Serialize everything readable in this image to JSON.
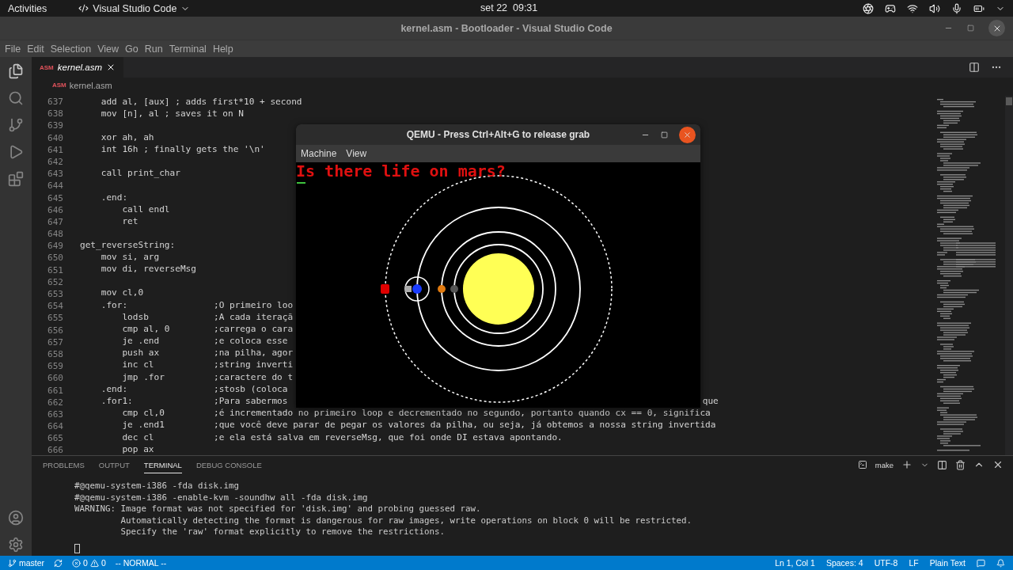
{
  "top_bar": {
    "activities": "Activities",
    "app_name": "Visual Studio Code",
    "clock": "set 22  09:31"
  },
  "window": {
    "title": "kernel.asm - Bootloader - Visual Studio Code"
  },
  "menu": [
    "File",
    "Edit",
    "Selection",
    "View",
    "Go",
    "Run",
    "Terminal",
    "Help"
  ],
  "editor_tabs": [
    {
      "icon_text": "ASM",
      "label": "kernel.asm",
      "selected": true
    }
  ],
  "breadcrumb": {
    "icon_text": "ASM",
    "label": "kernel.asm"
  },
  "code_lines": [
    {
      "n": "637",
      "code": "    add al, [aux] ; adds first*10 + second"
    },
    {
      "n": "638",
      "code": "    mov [n], al ; saves it on N"
    },
    {
      "n": "639"
    },
    {
      "n": "640",
      "code": "    xor ah, ah"
    },
    {
      "n": "641",
      "code": "    int 16h ; finally gets the '\\n'"
    },
    {
      "n": "642"
    },
    {
      "n": "643",
      "code": "    call print_char"
    },
    {
      "n": "644"
    },
    {
      "n": "645",
      "code": "    .end:"
    },
    {
      "n": "646",
      "code": "        call endl"
    },
    {
      "n": "647",
      "code": "        ret"
    },
    {
      "n": "648"
    },
    {
      "n": "649",
      "code": "get_reverseString:"
    },
    {
      "n": "650",
      "code": "    mov si, arg"
    },
    {
      "n": "651",
      "code": "    mov di, reverseMsg"
    },
    {
      "n": "652"
    },
    {
      "n": "653",
      "code": "    mov cl,0"
    },
    {
      "n": "654",
      "code": "    .for:",
      "comment": ";O primeiro loo"
    },
    {
      "n": "655",
      "code": "        lodsb",
      "comment": ";A cada iteraçã"
    },
    {
      "n": "656",
      "code": "        cmp al, 0",
      "comment": ";carrega o cara"
    },
    {
      "n": "657",
      "code": "        je .end",
      "comment": ";e coloca esse"
    },
    {
      "n": "658",
      "code": "        push ax",
      "comment": ";na pilha, agor"
    },
    {
      "n": "659",
      "code": "        inc cl",
      "comment": ";string inverti"
    },
    {
      "n": "660",
      "code": "        jmp .for",
      "comment": ";caractere do t"
    },
    {
      "n": "661",
      "code": "    .end:",
      "comment": ";stosb (coloca"
    },
    {
      "n": "662",
      "code": "    .for1:",
      "comment": ";Para sabermos",
      "tail": "que"
    },
    {
      "n": "663",
      "code": "        cmp cl,0",
      "comment": ";é incrementado no primeiro loop e decrementado no segundo, portanto quando cx == 0, significa"
    },
    {
      "n": "664",
      "code": "        je .end1",
      "comment": ";que você deve parar de pegar os valores da pilha, ou seja, já obtemos a nossa string invertida"
    },
    {
      "n": "665",
      "code": "        dec cl",
      "comment": ";e ela está salva em reverseMsg, que foi onde DI estava apontando."
    },
    {
      "n": "666",
      "code": "        pop ax"
    }
  ],
  "qemu": {
    "title": "QEMU - Press Ctrl+Alt+G to release grab",
    "menu": [
      "Machine",
      "View"
    ],
    "screen_text": "Is there life on mars?"
  },
  "panel": {
    "tabs": [
      {
        "label": "PROBLEMS",
        "selected": false
      },
      {
        "label": "OUTPUT",
        "selected": false
      },
      {
        "label": "TERMINAL",
        "selected": true
      },
      {
        "label": "DEBUG CONSOLE",
        "selected": false
      }
    ],
    "terminal_name": "make",
    "terminal_lines": [
      "#@qemu-system-i386 -fda disk.img",
      "#@qemu-system-i386 -enable-kvm -soundhw all -fda disk.img",
      "WARNING: Image format was not specified for 'disk.img' and probing guessed raw.",
      "         Automatically detecting the format is dangerous for raw images, write operations on block 0 will be restricted.",
      "         Specify the 'raw' format explicitly to remove the restrictions."
    ]
  },
  "status_bar": {
    "branch": "master",
    "errors": "0",
    "warnings": "0",
    "mode": "-- NORMAL --",
    "right": [
      "Ln 1, Col 1",
      "Spaces: 4",
      "UTF-8",
      "LF",
      "Plain Text"
    ]
  }
}
